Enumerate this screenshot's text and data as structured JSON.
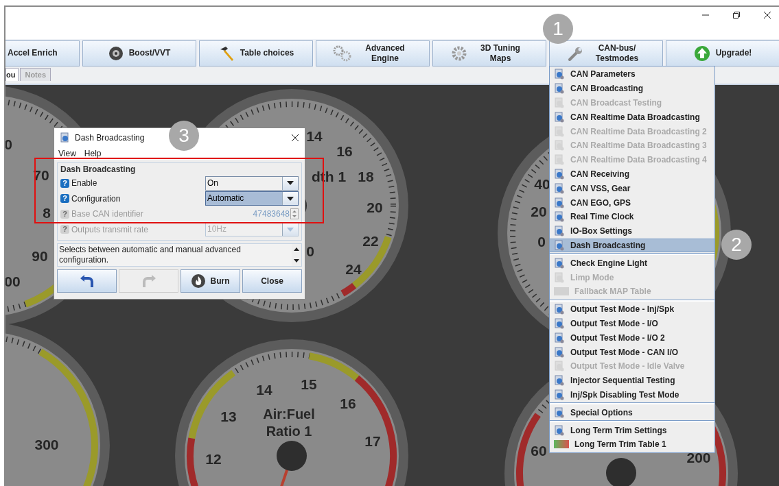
{
  "toolbar": [
    {
      "label": "Accel Enrich"
    },
    {
      "label": "Boost/VVT"
    },
    {
      "label": "Table choices"
    },
    {
      "label": "Advanced Engine"
    },
    {
      "label": "3D Tuning Maps"
    },
    {
      "label": "CAN-bus/ Testmodes"
    },
    {
      "label": "Upgrade!"
    }
  ],
  "tabs": [
    {
      "label": "ou",
      "selected": true
    },
    {
      "label": "Notes",
      "selected": false
    }
  ],
  "gauges": [
    {
      "labels": [
        "0",
        "70",
        "8",
        "90",
        "00"
      ]
    },
    {
      "labels": [
        "14",
        "16",
        "dth 1",
        "18",
        "20",
        "22",
        "24",
        "0"
      ]
    },
    {
      "labels": [
        "40",
        "20",
        "0"
      ]
    },
    {
      "labels": [
        "300"
      ]
    },
    {
      "labels": [
        "14",
        "15",
        "16",
        "13",
        "17",
        "12"
      ],
      "title": "Air:Fuel Ratio 1"
    },
    {
      "labels": [
        "60",
        "200"
      ]
    }
  ],
  "dialog": {
    "title": "Dash Broadcasting",
    "help_glyph": "?",
    "menu": [
      "View",
      "Help"
    ],
    "group_title": "Dash Broadcasting",
    "fields": [
      {
        "label": "Enable",
        "value": "On",
        "kind": "combo",
        "disabled": false,
        "selected": false
      },
      {
        "label": "Configuration",
        "value": "Automatic",
        "kind": "combo",
        "disabled": false,
        "selected": true
      },
      {
        "label": "Base CAN identifier",
        "value": "47483648",
        "kind": "spinner",
        "disabled": true,
        "selected": false
      },
      {
        "label": "Outputs transmit rate",
        "value": "10Hz",
        "kind": "combo",
        "disabled": true,
        "selected": false
      }
    ],
    "help_text": "Selects between automatic and manual advanced configuration.",
    "buttons": [
      {
        "kind": "undo",
        "disabled": false
      },
      {
        "kind": "redo",
        "disabled": true
      },
      {
        "kind": "burn",
        "label": "Burn",
        "disabled": false
      },
      {
        "kind": "close",
        "label": "Close",
        "disabled": false
      }
    ]
  },
  "menu": {
    "sections": [
      {
        "items": [
          {
            "label": "CAN Parameters",
            "kind": "dialog",
            "disabled": false,
            "selected": false
          },
          {
            "label": "CAN Broadcasting",
            "kind": "dialog",
            "disabled": false,
            "selected": false
          },
          {
            "label": "CAN Broadcast Testing",
            "kind": "dialog",
            "disabled": true,
            "selected": false
          },
          {
            "label": "CAN Realtime Data Broadcasting",
            "kind": "dialog",
            "disabled": false,
            "selected": false
          },
          {
            "label": "CAN Realtime Data Broadcasting 2",
            "kind": "dialog",
            "disabled": true,
            "selected": false
          },
          {
            "label": "CAN Realtime Data Broadcasting 3",
            "kind": "dialog",
            "disabled": true,
            "selected": false
          },
          {
            "label": "CAN Realtime Data Broadcasting 4",
            "kind": "dialog",
            "disabled": true,
            "selected": false
          },
          {
            "label": "CAN Receiving",
            "kind": "dialog",
            "disabled": false,
            "selected": false
          },
          {
            "label": "CAN VSS, Gear",
            "kind": "dialog",
            "disabled": false,
            "selected": false
          },
          {
            "label": "CAN EGO, GPS",
            "kind": "dialog",
            "disabled": false,
            "selected": false
          },
          {
            "label": "Real Time Clock",
            "kind": "dialog",
            "disabled": false,
            "selected": false
          },
          {
            "label": "IO-Box Settings",
            "kind": "dialog",
            "disabled": false,
            "selected": false
          },
          {
            "label": "Dash Broadcasting",
            "kind": "dialog",
            "disabled": false,
            "selected": true
          }
        ]
      },
      {
        "items": [
          {
            "label": "Check Engine Light",
            "kind": "dialog",
            "disabled": false,
            "selected": false
          },
          {
            "label": "Limp Mode",
            "kind": "dialog",
            "disabled": true,
            "selected": false
          },
          {
            "label": "Fallback MAP Table",
            "kind": "table",
            "disabled": true,
            "selected": false
          }
        ]
      },
      {
        "items": [
          {
            "label": "Output Test Mode - Inj/Spk",
            "kind": "dialog",
            "disabled": false,
            "selected": false
          },
          {
            "label": "Output Test Mode - I/O",
            "kind": "dialog",
            "disabled": false,
            "selected": false
          },
          {
            "label": "Output Test Mode - I/O 2",
            "kind": "dialog",
            "disabled": false,
            "selected": false
          },
          {
            "label": "Output Test Mode - CAN I/O",
            "kind": "dialog",
            "disabled": false,
            "selected": false
          },
          {
            "label": "Output Test Mode - Idle Valve",
            "kind": "dialog",
            "disabled": true,
            "selected": false
          },
          {
            "label": "Injector Sequential Testing",
            "kind": "dialog",
            "disabled": false,
            "selected": false
          },
          {
            "label": "Inj/Spk Disabling Test Mode",
            "kind": "dialog",
            "disabled": false,
            "selected": false
          }
        ]
      },
      {
        "items": [
          {
            "label": "Special Options",
            "kind": "dialog",
            "disabled": false,
            "selected": false
          }
        ]
      },
      {
        "items": [
          {
            "label": "Long Term Trim Settings",
            "kind": "dialog",
            "disabled": false,
            "selected": false
          },
          {
            "label": "Long Term Trim Table 1",
            "kind": "table",
            "disabled": false,
            "selected": false
          }
        ]
      }
    ]
  },
  "callouts": [
    "1",
    "2",
    "3"
  ]
}
